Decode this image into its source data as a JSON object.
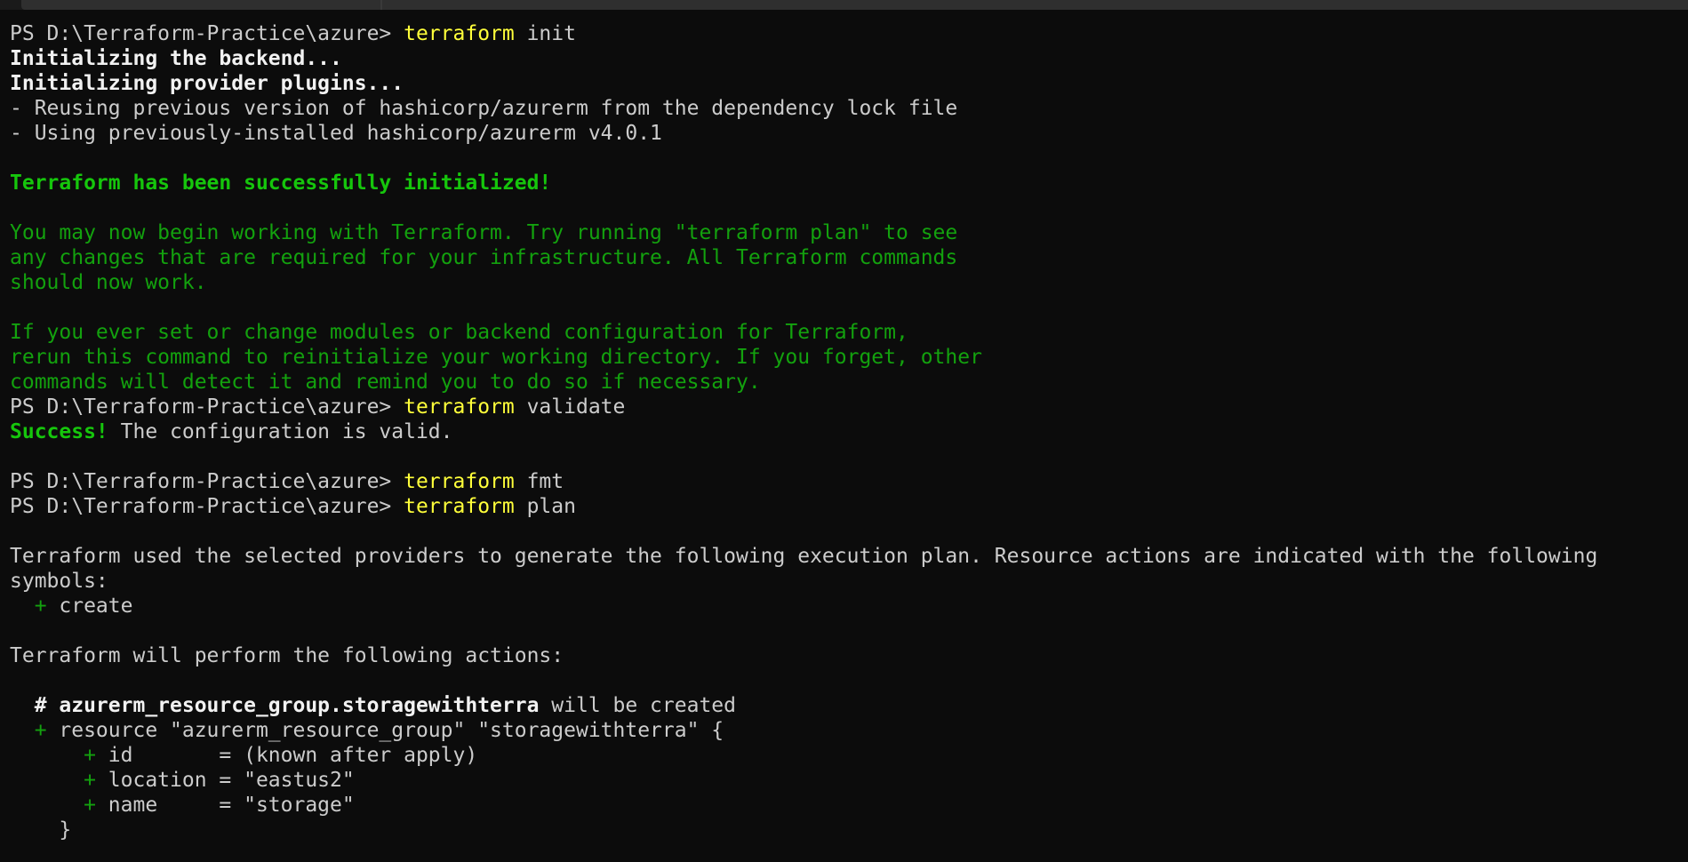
{
  "terminal": {
    "prompt": "PS D:\\Terraform-Practice\\azure> ",
    "commands": {
      "init": {
        "cmd": "terraform",
        "args": " init"
      },
      "validate": {
        "cmd": "terraform",
        "args": " validate"
      },
      "fmt": {
        "cmd": "terraform",
        "args": " fmt"
      },
      "plan": {
        "cmd": "terraform",
        "args": " plan"
      }
    },
    "init_output": {
      "backend": "Initializing the backend...",
      "plugins": "Initializing provider plugins...",
      "reusing": "- Reusing previous version of hashicorp/azurerm from the dependency lock file",
      "using": "- Using previously-installed hashicorp/azurerm v4.0.1",
      "success": "Terraform has been successfully initialized!",
      "info1": "You may now begin working with Terraform. Try running \"terraform plan\" to see",
      "info2": "any changes that are required for your infrastructure. All Terraform commands",
      "info3": "should now work.",
      "info4": "If you ever set or change modules or backend configuration for Terraform,",
      "info5": "rerun this command to reinitialize your working directory. If you forget, other",
      "info6": "commands will detect it and remind you to do so if necessary."
    },
    "validate_output": {
      "success_word": "Success!",
      "rest": " The configuration is valid."
    },
    "plan_output": {
      "intro1": "Terraform used the selected providers to generate the following execution plan. Resource actions are indicated with the following",
      "intro2": "symbols:",
      "create_plus": "  + ",
      "create_label": "create",
      "actions": "Terraform will perform the following actions:",
      "comment_hash": "  # ",
      "comment_resource": "azurerm_resource_group.storagewithterra",
      "comment_rest": " will be created",
      "resource_plus": "  + ",
      "resource_decl": "resource \"azurerm_resource_group\" \"storagewithterra\" {",
      "attrs": [
        {
          "plus": "      + ",
          "text": "id       = (known after apply)"
        },
        {
          "plus": "      + ",
          "text": "location = \"eastus2\""
        },
        {
          "plus": "      + ",
          "text": "name     = \"storage\""
        }
      ],
      "close_brace": "    }"
    }
  }
}
